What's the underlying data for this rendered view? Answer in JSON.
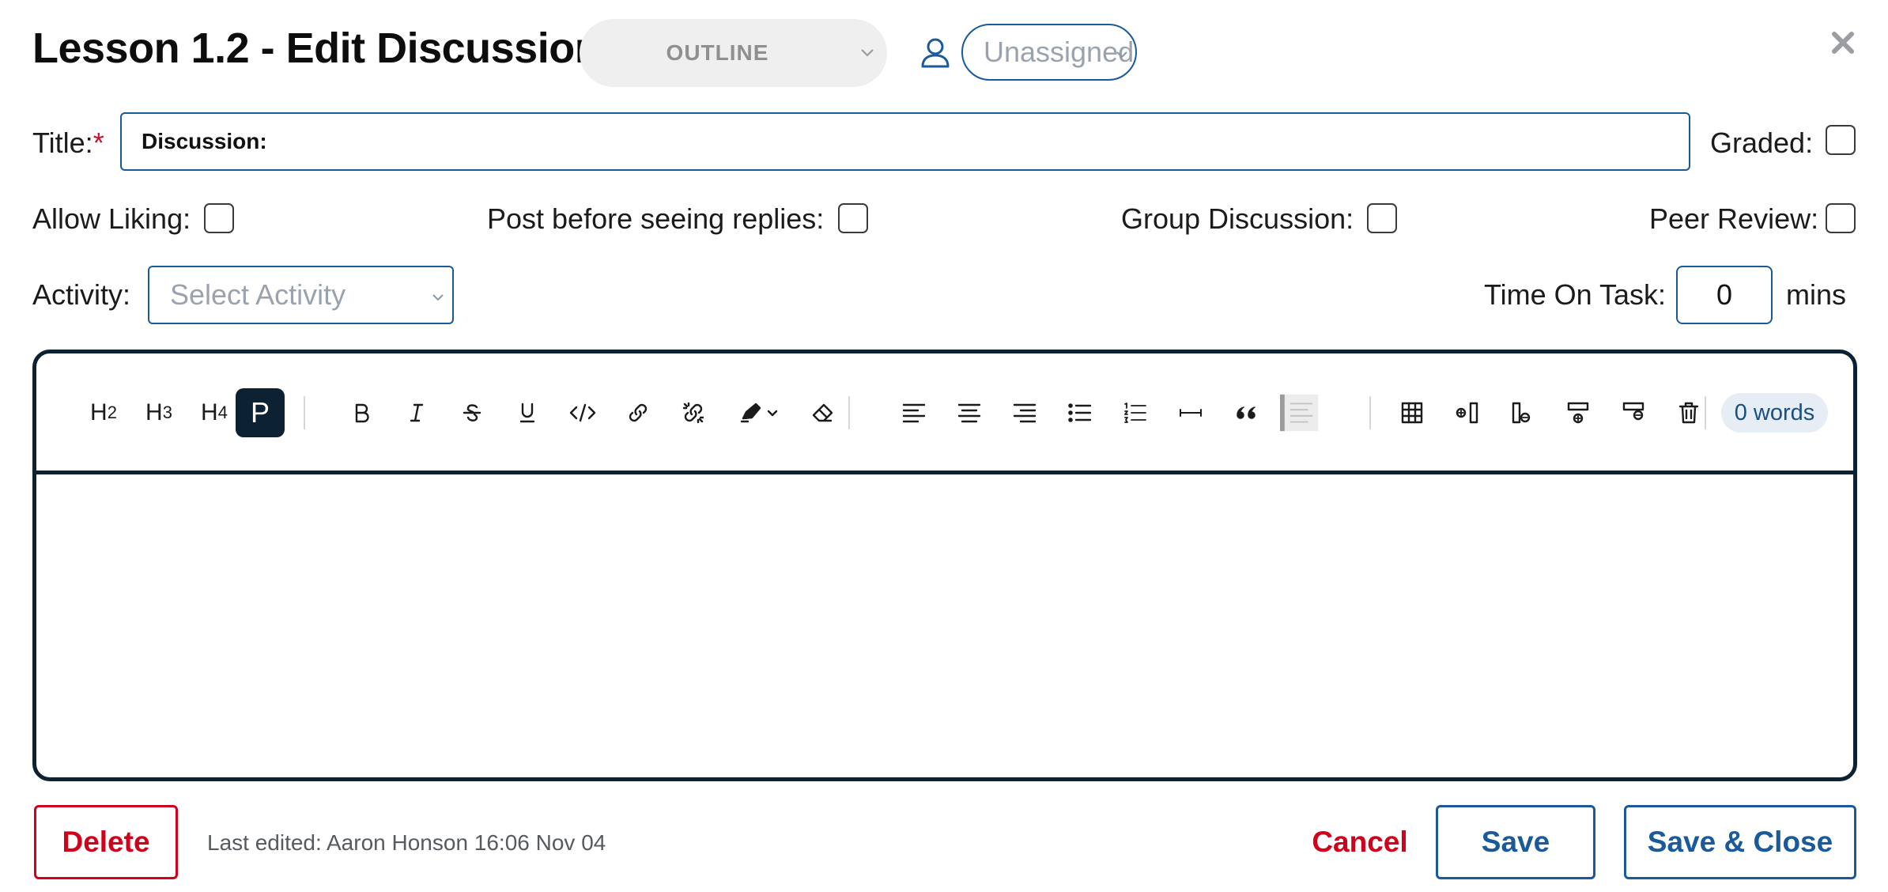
{
  "header": {
    "title": "Lesson 1.2 - Edit Discussion",
    "status": "OUTLINE",
    "assignee": "Unassigned"
  },
  "form": {
    "title_label": "Title:",
    "required_mark": "*",
    "title_value": "Discussion:",
    "graded_label": "Graded:",
    "allow_liking_label": "Allow Liking:",
    "post_before_label": "Post before seeing replies:",
    "group_discussion_label": "Group Discussion:",
    "peer_review_label": "Peer Review:",
    "activity_label": "Activity:",
    "activity_placeholder": "Select Activity",
    "time_on_task_label": "Time On Task:",
    "time_on_task_value": "0",
    "time_unit": "mins"
  },
  "editor": {
    "toolbar": {
      "h2": "H",
      "h2_sub": "2",
      "h3": "H",
      "h3_sub": "3",
      "h4": "H",
      "h4_sub": "4",
      "paragraph": "P"
    },
    "word_count": "0 words"
  },
  "footer": {
    "delete_label": "Delete",
    "last_edited": "Last edited: Aaron Honson 16:06 Nov 04",
    "cancel_label": "Cancel",
    "save_label": "Save",
    "save_close_label": "Save & Close"
  },
  "colors": {
    "brand_blue": "#1a5a9a",
    "danger_red": "#d0021b",
    "editor_border": "#0c2233"
  }
}
